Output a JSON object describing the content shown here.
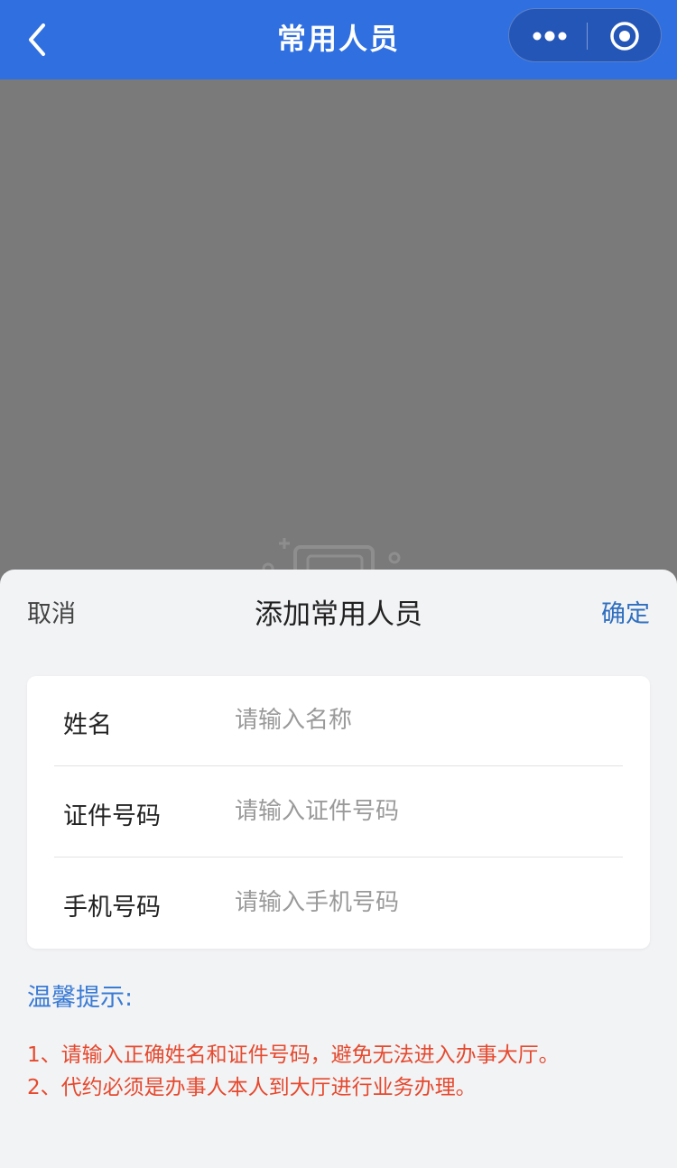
{
  "header": {
    "title": "常用人员"
  },
  "sheet": {
    "cancel_label": "取消",
    "title": "添加常用人员",
    "confirm_label": "确定"
  },
  "form": {
    "fields": [
      {
        "label": "姓名",
        "placeholder": "请输入名称",
        "value": ""
      },
      {
        "label": "证件号码",
        "placeholder": "请输入证件号码",
        "value": ""
      },
      {
        "label": "手机号码",
        "placeholder": "请输入手机号码",
        "value": ""
      }
    ]
  },
  "tips": {
    "title": "温馨提示:",
    "items": [
      "1、请输入正确姓名和证件号码，避免无法进入办事大厅。",
      "2、代约必须是办事人本人到大厅进行业务办理。"
    ]
  },
  "colors": {
    "header_blue": "#2f6fe0",
    "confirm_blue": "#2f6fbf",
    "tip_red": "#e6492e"
  },
  "icons": [
    "back-icon",
    "more-dots-icon",
    "target-icon",
    "empty-state-illustration"
  ]
}
